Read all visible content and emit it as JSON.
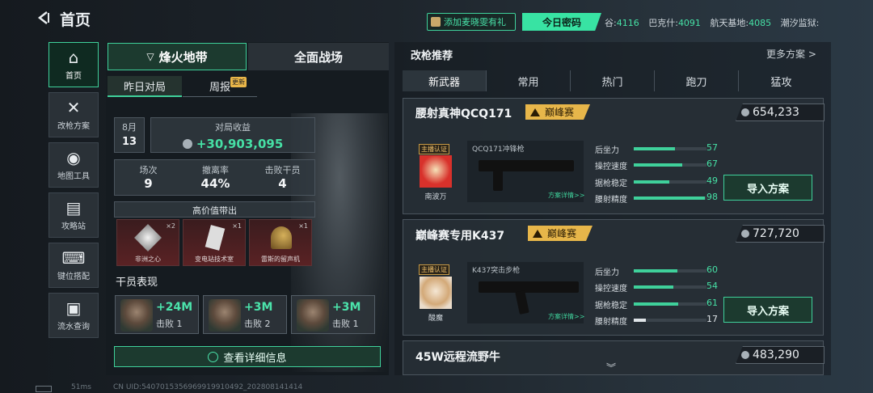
{
  "header": {
    "title": "首页",
    "promo": "添加麦晓雯有礼",
    "code_btn": "今日密码",
    "codes": [
      {
        "label": "谷:",
        "value": "4116"
      },
      {
        "label": "巴克什:",
        "value": "4091"
      },
      {
        "label": "航天基地:",
        "value": "4085"
      },
      {
        "label": "潮汐监狱:",
        "value": ""
      }
    ]
  },
  "nav": [
    {
      "label": "首页",
      "icon": "home-icon",
      "active": true
    },
    {
      "label": "改枪方案",
      "icon": "wrench-icon"
    },
    {
      "label": "地图工具",
      "icon": "map-pin-icon"
    },
    {
      "label": "攻略站",
      "icon": "book-icon"
    },
    {
      "label": "键位搭配",
      "icon": "keyboard-icon"
    },
    {
      "label": "流水查询",
      "icon": "ledger-icon"
    }
  ],
  "left": {
    "tab_a": "烽火地带",
    "tab_b": "全面战场",
    "sub_a": "昨日对局",
    "sub_b": "周报",
    "new_badge": "更新",
    "month": "8月",
    "day": "13",
    "income_label": "对局收益",
    "income": "+30,903,095",
    "stats": [
      {
        "label": "场次",
        "value": "9"
      },
      {
        "label": "撤离率",
        "value": "44%"
      },
      {
        "label": "击败干员",
        "value": "4"
      }
    ],
    "loot_title": "高价值带出",
    "loot": [
      {
        "name": "非洲之心",
        "count": "×2"
      },
      {
        "name": "变电站技术室",
        "count": "×1"
      },
      {
        "name": "雷斯的留声机",
        "count": "×1"
      }
    ],
    "ops_title": "干员表现",
    "ops": [
      {
        "gain": "+24M",
        "kd": "击败 1"
      },
      {
        "gain": "+3M",
        "kd": "击败 2"
      },
      {
        "gain": "+3M",
        "kd": "击败 1"
      }
    ],
    "detail_btn": "查看详细信息"
  },
  "right": {
    "title": "改枪推荐",
    "more": "更多方案 >",
    "tabs": [
      "新武器",
      "常用",
      "热门",
      "跑刀",
      "猛攻"
    ],
    "stat_labels": [
      "后坐力",
      "操控速度",
      "据枪稳定",
      "腰射精度"
    ],
    "import": "导入方案",
    "detail_link": "方案详情>>",
    "streamer_tag": "主播认证",
    "peak_tag": "巅峰赛",
    "weapons": [
      {
        "name": "腰射真神QCQ171",
        "price": "654,233",
        "gun": "QCQ171冲锋枪",
        "streamer": "南波万",
        "stats": [
          57,
          67,
          49,
          98
        ]
      },
      {
        "name": "巅峰赛专用K437",
        "price": "727,720",
        "gun": "K437突击步枪",
        "streamer": "酸魔",
        "stats": [
          60,
          54,
          61,
          17
        ]
      },
      {
        "name": "45W远程流野牛",
        "price": "483,290"
      }
    ]
  },
  "footer": {
    "uid": "CN UID:5407015356969919910492_202808141414",
    "ping": "51ms"
  }
}
